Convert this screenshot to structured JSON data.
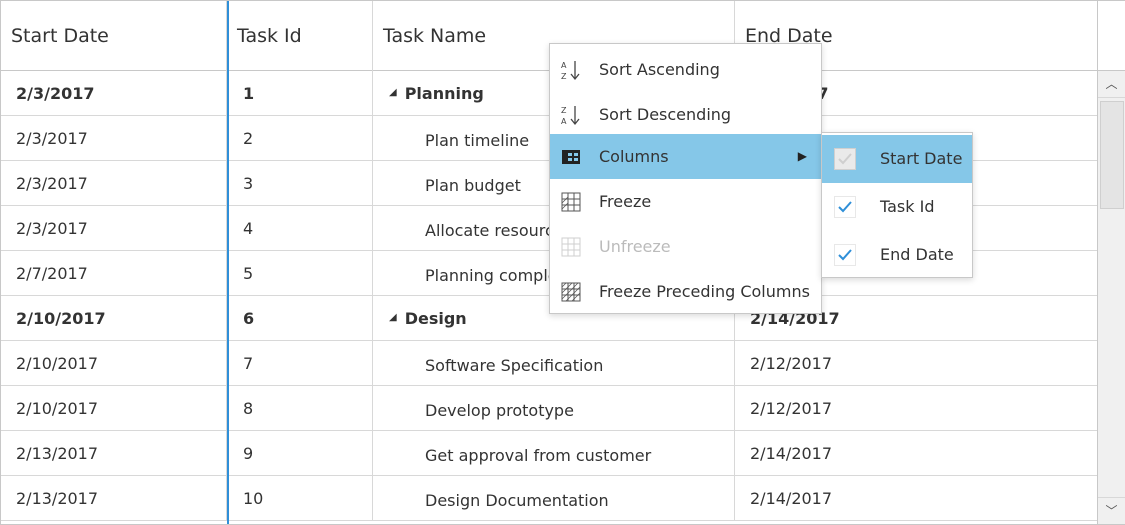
{
  "columns": {
    "start_date": "Start Date",
    "task_id": "Task Id",
    "task_name": "Task Name",
    "end_date": "End Date"
  },
  "rows": [
    {
      "start": "2/3/2017",
      "id": "1",
      "name": "Planning",
      "end": "2/7/2017",
      "parent": true
    },
    {
      "start": "2/3/2017",
      "id": "2",
      "name": "Plan timeline",
      "end": "",
      "parent": false
    },
    {
      "start": "2/3/2017",
      "id": "3",
      "name": "Plan budget",
      "end": "",
      "parent": false
    },
    {
      "start": "2/3/2017",
      "id": "4",
      "name": "Allocate resources",
      "end": "",
      "parent": false
    },
    {
      "start": "2/7/2017",
      "id": "5",
      "name": "Planning complete",
      "end": "",
      "parent": false
    },
    {
      "start": "2/10/2017",
      "id": "6",
      "name": "Design",
      "end": "2/14/2017",
      "parent": true
    },
    {
      "start": "2/10/2017",
      "id": "7",
      "name": "Software Specification",
      "end": "2/12/2017",
      "parent": false
    },
    {
      "start": "2/10/2017",
      "id": "8",
      "name": "Develop prototype",
      "end": "2/12/2017",
      "parent": false
    },
    {
      "start": "2/13/2017",
      "id": "9",
      "name": "Get approval from customer",
      "end": "2/14/2017",
      "parent": false
    },
    {
      "start": "2/13/2017",
      "id": "10",
      "name": "Design Documentation",
      "end": "2/14/2017",
      "parent": false
    }
  ],
  "context_menu": {
    "items": [
      {
        "label": "Sort Ascending",
        "icon": "sort-ascending-icon"
      },
      {
        "label": "Sort Descending",
        "icon": "sort-descending-icon"
      },
      {
        "label": "Columns",
        "icon": "columns-icon",
        "active": true,
        "submenu": true
      },
      {
        "label": "Freeze",
        "icon": "freeze-icon"
      },
      {
        "label": "Unfreeze",
        "icon": "unfreeze-icon",
        "disabled": true
      },
      {
        "label": "Freeze Preceding Columns",
        "icon": "freeze-preceding-icon"
      }
    ]
  },
  "columns_submenu": {
    "items": [
      {
        "label": "Start Date",
        "checked": true,
        "disabled": true,
        "active": true
      },
      {
        "label": "Task Id",
        "checked": true
      },
      {
        "label": "End Date",
        "checked": true
      }
    ]
  },
  "colors": {
    "accent": "#2f8fd8",
    "menu_highlight": "#85c7e8",
    "check_color": "#2f8fd8"
  }
}
